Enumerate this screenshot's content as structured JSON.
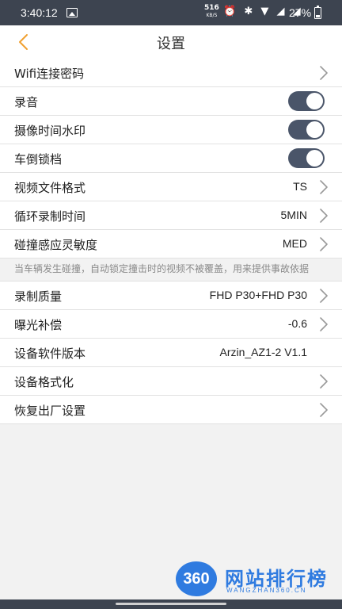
{
  "status_bar": {
    "time": "3:40:12",
    "net_speed": "516",
    "net_unit": "KB/S",
    "status_icons": "⏰ ✱ ▼ ◢ ◢",
    "battery": "27%"
  },
  "header": {
    "title": "设置"
  },
  "settings": [
    {
      "label": "Wifi连接密码",
      "value": "",
      "type": "link"
    },
    {
      "label": "录音",
      "type": "toggle",
      "on": true
    },
    {
      "label": "摄像时间水印",
      "type": "toggle",
      "on": true
    },
    {
      "label": "车倒锁档",
      "type": "toggle",
      "on": true
    },
    {
      "label": "视频文件格式",
      "value": "TS",
      "type": "link"
    },
    {
      "label": "循环录制时间",
      "value": "5MIN",
      "type": "link"
    },
    {
      "label": "碰撞感应灵敏度",
      "value": "MED",
      "type": "link"
    }
  ],
  "note": "当车辆发生碰撞，自动锁定撞击时的视频不被覆盖，用来提供事故依据",
  "settings2": [
    {
      "label": "录制质量",
      "value": "FHD P30+FHD P30",
      "type": "link"
    },
    {
      "label": "曝光补偿",
      "value": "-0.6",
      "type": "link"
    },
    {
      "label": "设备软件版本",
      "value": "Arzin_AZ1-2 V1.1",
      "type": "info"
    },
    {
      "label": "设备格式化",
      "value": "",
      "type": "link"
    },
    {
      "label": "恢复出厂设置",
      "value": "",
      "type": "link"
    }
  ],
  "watermark": {
    "badge": "360",
    "text": "网站排行榜",
    "sub": "WANGZHAN360.CN"
  },
  "colors": {
    "accent": "#f0a030",
    "toggle_on": "#4a5569",
    "status_bar": "#3d4450"
  },
  "icons": {
    "back": "chevron-left-icon",
    "row_arrow": "chevron-right-icon"
  }
}
